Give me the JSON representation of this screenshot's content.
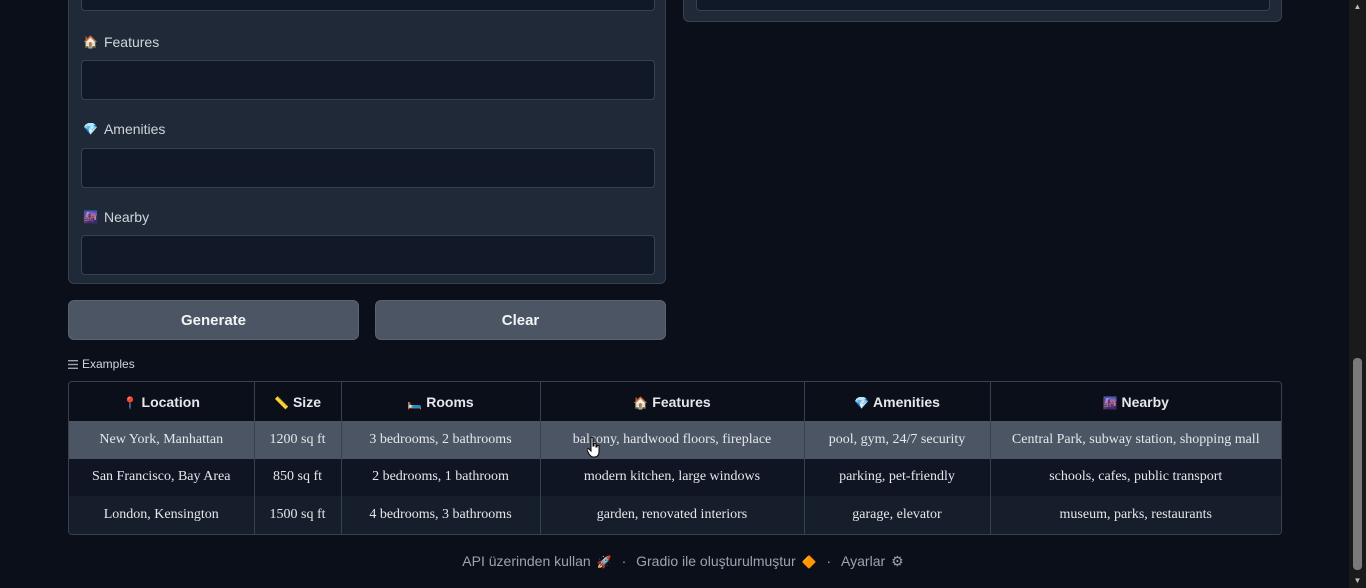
{
  "form": {
    "features_label": "Features",
    "features_icon": "🏠",
    "amenities_label": "Amenities",
    "amenities_icon": "💎",
    "nearby_label": "Nearby",
    "nearby_icon": "🌆",
    "features_value": "",
    "amenities_value": "",
    "nearby_value": ""
  },
  "buttons": {
    "generate": "Generate",
    "clear": "Clear"
  },
  "examples": {
    "label": "Examples",
    "headers": [
      {
        "icon": "📍",
        "text": "Location"
      },
      {
        "icon": "📏",
        "text": "Size"
      },
      {
        "icon": "🛏️",
        "text": "Rooms"
      },
      {
        "icon": "🏠",
        "text": "Features"
      },
      {
        "icon": "💎",
        "text": "Amenities"
      },
      {
        "icon": "🌆",
        "text": "Nearby"
      }
    ],
    "rows": [
      [
        "New York, Manhattan",
        "1200 sq ft",
        "3 bedrooms, 2 bathrooms",
        "balcony, hardwood floors, fireplace",
        "pool, gym, 24/7 security",
        "Central Park, subway station, shopping mall"
      ],
      [
        "San Francisco, Bay Area",
        "850 sq ft",
        "2 bedrooms, 1 bathroom",
        "modern kitchen, large windows",
        "parking, pet-friendly",
        "schools, cafes, public transport"
      ],
      [
        "London, Kensington",
        "1500 sq ft",
        "4 bedrooms, 3 bathrooms",
        "garden, renovated interiors",
        "garage, elevator",
        "museum, parks, restaurants"
      ]
    ]
  },
  "footer": {
    "api": "API üzerinden kullan",
    "api_icon": "🚀",
    "sep": "·",
    "built": "Gradio ile oluşturulmuştur",
    "built_icon": "🔶",
    "settings": "Ayarlar",
    "settings_icon": "⚙"
  }
}
